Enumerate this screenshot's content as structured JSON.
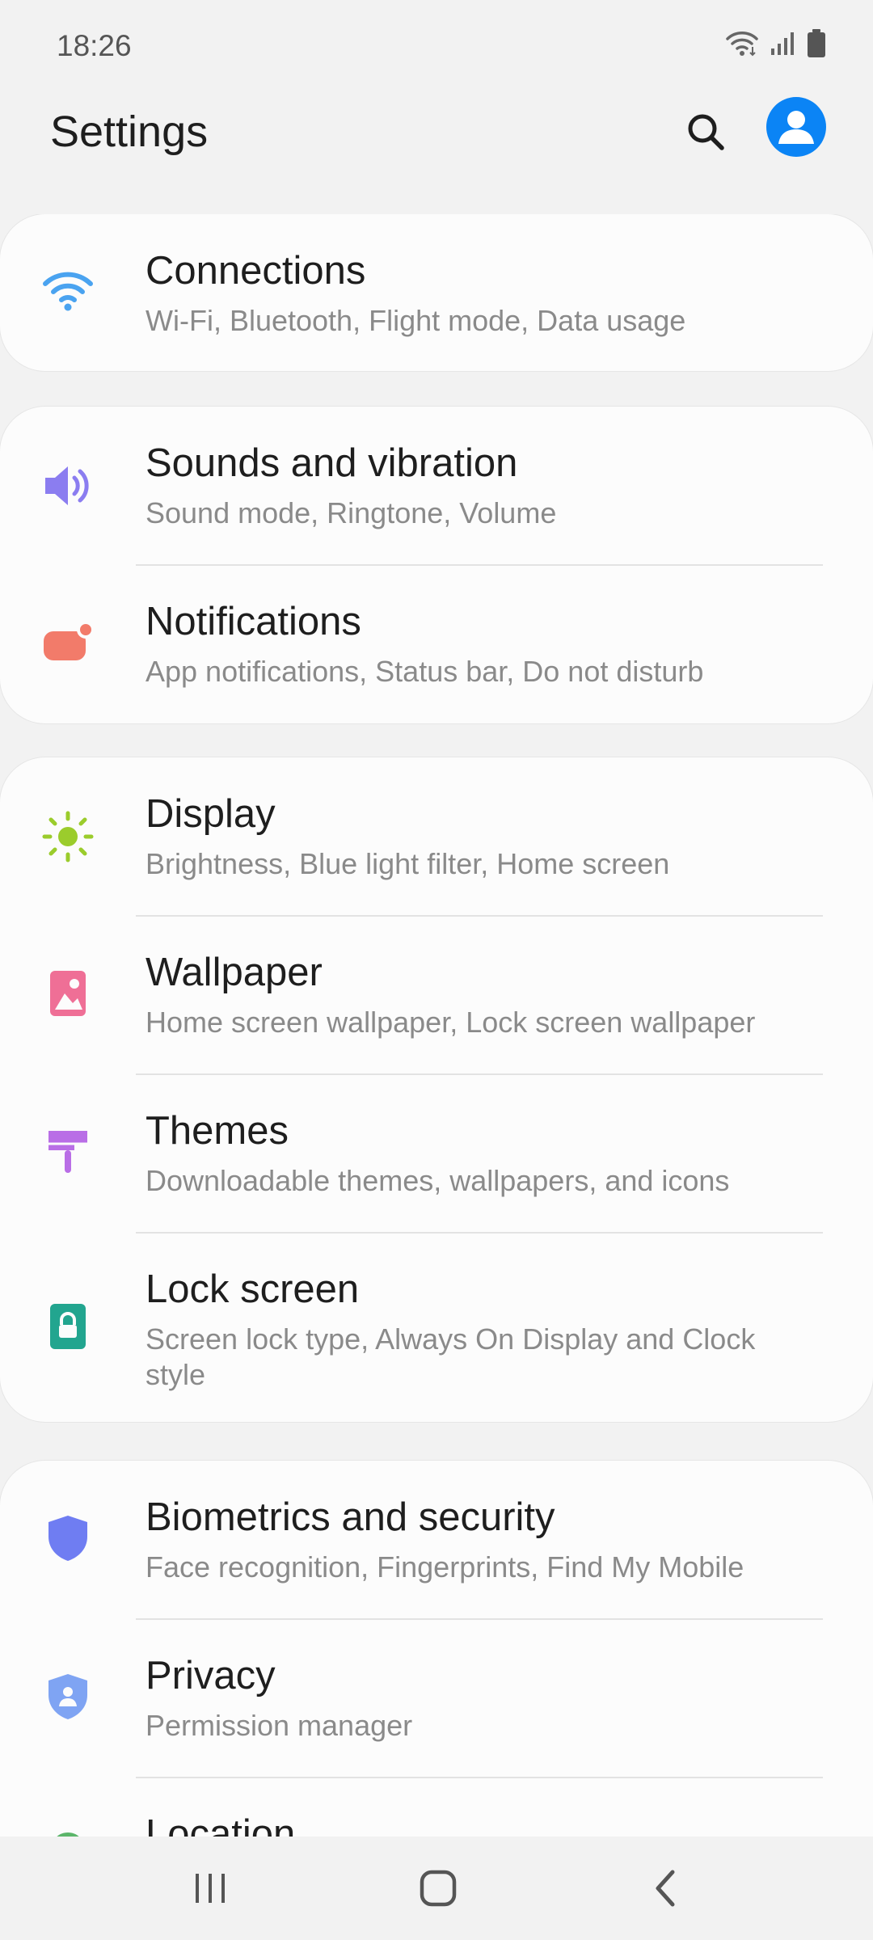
{
  "status": {
    "time": "18:26"
  },
  "header": {
    "title": "Settings"
  },
  "colors": {
    "accent": "#0b84f5",
    "connections_icon": "#4aa3f0",
    "sounds_icon": "#8b7df0",
    "notifications_icon": "#f27b6a",
    "display_icon": "#9bcc2c",
    "wallpaper_icon": "#ef6f96",
    "themes_icon": "#b96ee6",
    "lock_icon": "#22a58f",
    "biometrics_icon": "#6f7df2",
    "privacy_icon": "#7fa4f3",
    "location_icon": "#5bb56a"
  },
  "groups": [
    {
      "items": [
        {
          "icon": "wifi-icon",
          "title": "Connections",
          "subtitle": "Wi-Fi, Bluetooth, Flight mode, Data usage"
        }
      ]
    },
    {
      "items": [
        {
          "icon": "speaker-icon",
          "title": "Sounds and vibration",
          "subtitle": "Sound mode, Ringtone, Volume"
        },
        {
          "icon": "notification-icon",
          "title": "Notifications",
          "subtitle": "App notifications, Status bar, Do not disturb"
        }
      ]
    },
    {
      "items": [
        {
          "icon": "brightness-icon",
          "title": "Display",
          "subtitle": "Brightness, Blue light filter, Home screen"
        },
        {
          "icon": "wallpaper-icon",
          "title": "Wallpaper",
          "subtitle": "Home screen wallpaper, Lock screen wallpaper"
        },
        {
          "icon": "paintbrush-icon",
          "title": "Themes",
          "subtitle": "Downloadable themes, wallpapers, and icons"
        },
        {
          "icon": "lock-icon",
          "title": "Lock screen",
          "subtitle": "Screen lock type, Always On Display and Clock style"
        }
      ]
    },
    {
      "items": [
        {
          "icon": "shield-icon",
          "title": "Biometrics and security",
          "subtitle": "Face recognition, Fingerprints, Find My Mobile"
        },
        {
          "icon": "privacy-shield-icon",
          "title": "Privacy",
          "subtitle": "Permission manager"
        },
        {
          "icon": "location-pin-icon",
          "title": "Location",
          "subtitle": ""
        }
      ]
    }
  ],
  "nav": {
    "recents_icon": "recents-icon",
    "home_icon": "home-icon",
    "back_icon": "back-icon"
  }
}
